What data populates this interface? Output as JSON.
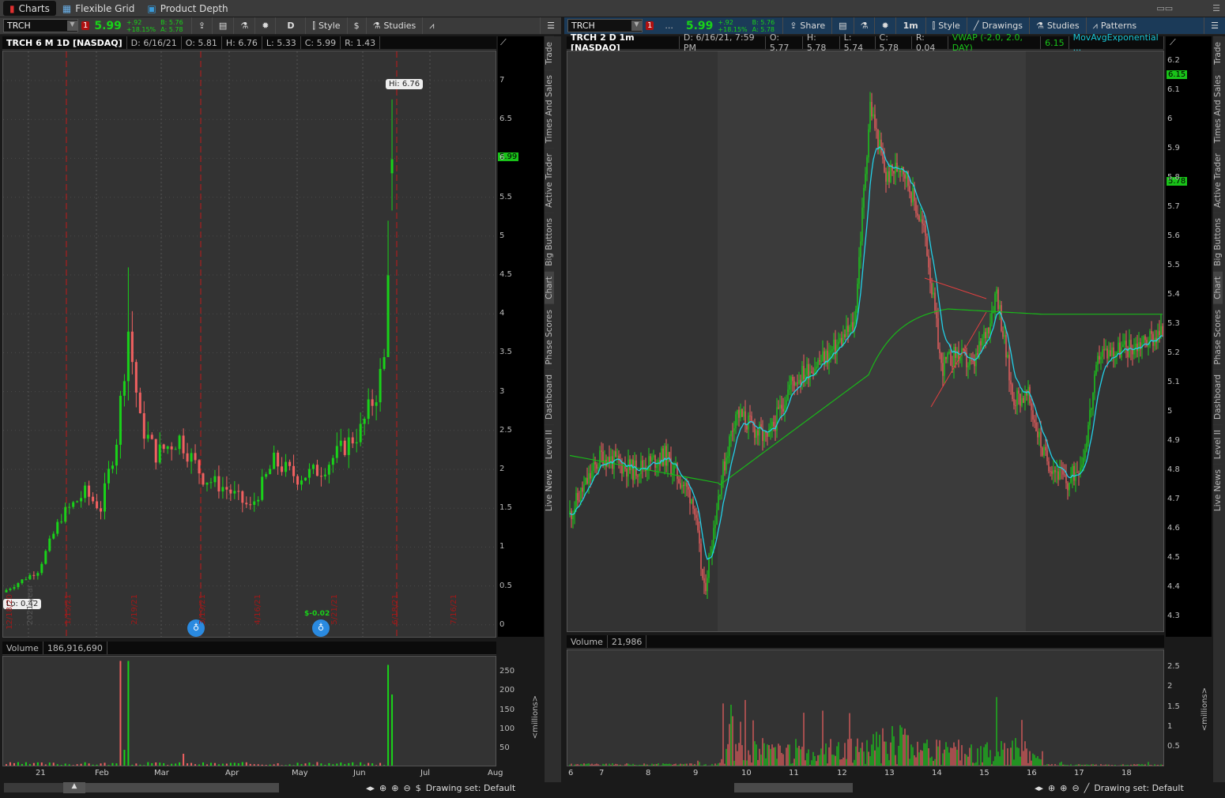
{
  "top_tabs": [
    {
      "label": "Charts"
    },
    {
      "label": "Flexible Grid"
    },
    {
      "label": "Product Depth"
    }
  ],
  "left": {
    "symbol": "TRCH",
    "alert_count": "1",
    "last": "5.99",
    "change": "+.92",
    "change_pct": "+18.15%",
    "bid": "B: 5.76",
    "ask": "A: 5.78",
    "aggregation": "D",
    "style_label": "Style",
    "studies_label": "Studies",
    "header": {
      "title": "TRCH 6 M 1D [NASDAQ]",
      "d": "D: 6/16/21",
      "o": "O: 5.81",
      "h": "H: 6.76",
      "l": "L: 5.33",
      "c": "C: 5.99",
      "r": "R: 1.43"
    },
    "price_ticks": [
      "7",
      "6.5",
      "6",
      "5.5",
      "5",
      "4.5",
      "4",
      "3.5",
      "3",
      "2.5",
      "2",
      "1.5",
      "1",
      "0.5",
      "0"
    ],
    "price_tag": "5.99",
    "hi_label": "Hi: 6.76",
    "lo_label": "Lo: 0.42",
    "expiry_labels": [
      "12/18/20",
      "1/15/21",
      "2/19/21",
      "3/19/21",
      "4/16/21",
      "5/21/21",
      "6/18/21",
      "7/16/21"
    ],
    "year_label": "2021 year",
    "dividend_label": "$-0.02",
    "volume_label": "Volume",
    "volume_value": "186,916,690",
    "volume_ticks": [
      "250",
      "200",
      "150",
      "100",
      "50"
    ],
    "volume_unit": "<millions>",
    "time_ticks": [
      "21",
      "Feb",
      "Mar",
      "Apr",
      "May",
      "Jun",
      "Jul",
      "Aug"
    ],
    "drawing_set": "Drawing set: Default"
  },
  "right": {
    "symbol": "TRCH",
    "alert_count": "1",
    "more": "...",
    "last": "5.99",
    "change": "+.92",
    "change_pct": "+18.15%",
    "bid": "B: 5.76",
    "ask": "A: 5.78",
    "share_label": "Share",
    "aggregation": "1m",
    "style_label": "Style",
    "drawings_label": "Drawings",
    "studies_label": "Studies",
    "patterns_label": "Patterns",
    "header": {
      "title": "TRCH 2 D 1m [NASDAQ]",
      "d": "D: 6/16/21, 7:59 PM",
      "o": "O: 5.77",
      "h": "H: 5.78",
      "l": "L: 5.74",
      "c": "C: 5.78",
      "r": "R: 0.04",
      "vwap": "VWAP (-2.0, 2.0, DAY)",
      "vwap_val": "6.15",
      "ema": "MovAvgExponential ..."
    },
    "price_ticks": [
      "6.2",
      "6.1",
      "6",
      "5.9",
      "5.8",
      "5.7",
      "5.6",
      "5.5",
      "5.4",
      "5.3",
      "5.2",
      "5.1",
      "5",
      "4.9",
      "4.8",
      "4.7",
      "4.6",
      "4.5",
      "4.4",
      "4.3"
    ],
    "tag_vwap": "6.15",
    "tag_last": "5.78",
    "volume_label": "Volume",
    "volume_value": "21,986",
    "volume_ticks": [
      "2.5",
      "2",
      "1.5",
      "1",
      "0.5"
    ],
    "volume_unit": "<millions>",
    "time_ticks": [
      "6",
      "7",
      "8",
      "9",
      "10",
      "11",
      "12",
      "13",
      "14",
      "15",
      "16",
      "17",
      "18"
    ],
    "drawing_set": "Drawing set: Default"
  },
  "side_tabs": [
    "Trade",
    "Times And Sales",
    "Active Trader",
    "Big Buttons",
    "Chart",
    "Phase Scores",
    "Dashboard",
    "Level II",
    "Live News"
  ],
  "chart_data": {
    "daily_close_keypoints": [
      [
        0,
        0.45
      ],
      [
        8,
        0.7
      ],
      [
        14,
        1.4
      ],
      [
        20,
        1.7
      ],
      [
        24,
        1.5
      ],
      [
        28,
        2.4
      ],
      [
        31,
        3.8
      ],
      [
        34,
        2.6
      ],
      [
        38,
        2.2
      ],
      [
        44,
        2.4
      ],
      [
        50,
        1.9
      ],
      [
        56,
        1.75
      ],
      [
        62,
        1.5
      ],
      [
        68,
        2.1
      ],
      [
        74,
        1.9
      ],
      [
        80,
        2.0
      ],
      [
        86,
        2.3
      ],
      [
        90,
        2.5
      ],
      [
        94,
        3.0
      ],
      [
        96,
        3.4
      ],
      [
        97,
        4.7
      ],
      [
        98,
        5.99
      ]
    ],
    "intraday_close_keypoints": [
      [
        0,
        4.65
      ],
      [
        10,
        4.75
      ],
      [
        20,
        4.85
      ],
      [
        40,
        4.8
      ],
      [
        60,
        4.85
      ],
      [
        78,
        4.7
      ],
      [
        85,
        4.38
      ],
      [
        95,
        4.75
      ],
      [
        105,
        5.0
      ],
      [
        125,
        4.9
      ],
      [
        140,
        5.1
      ],
      [
        165,
        5.2
      ],
      [
        180,
        5.3
      ],
      [
        190,
        6.05
      ],
      [
        200,
        5.8
      ],
      [
        210,
        5.85
      ],
      [
        225,
        5.6
      ],
      [
        235,
        5.15
      ],
      [
        245,
        5.2
      ],
      [
        255,
        5.15
      ],
      [
        265,
        5.3
      ],
      [
        270,
        5.42
      ],
      [
        280,
        5.05
      ],
      [
        290,
        5.05
      ],
      [
        300,
        4.85
      ],
      [
        315,
        4.75
      ],
      [
        325,
        4.85
      ],
      [
        335,
        5.2
      ],
      [
        355,
        5.22
      ],
      [
        375,
        5.27
      ]
    ]
  }
}
